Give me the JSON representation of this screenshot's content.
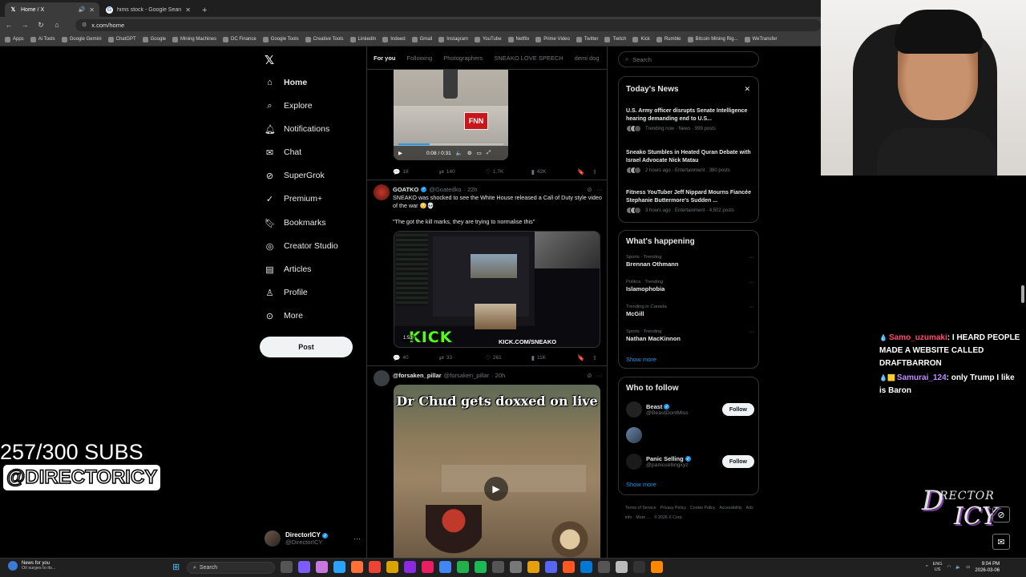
{
  "browser": {
    "tabs": [
      {
        "title": "Home / X",
        "icon": "x-logo-icon",
        "active": true
      },
      {
        "title": "hims stock - Google Search",
        "icon": "google-icon",
        "active": false
      }
    ],
    "url": "x.com/home",
    "bookmarks": [
      "Apps",
      "Ai Tools",
      "Google Gemini",
      "ChatGPT",
      "Google",
      "Mining Machines",
      "DC Finance",
      "Google Tools",
      "Creative Tools",
      "LinkedIn",
      "Indeed",
      "Gmail",
      "Instagram",
      "YouTube",
      "Netflix",
      "Prime Video",
      "Twitter",
      "Twitch",
      "Kick",
      "Rumble",
      "Bitcoin Mining Rig...",
      "WeTransfer"
    ]
  },
  "nav": {
    "items": [
      {
        "label": "Home",
        "icon": "home-icon"
      },
      {
        "label": "Explore",
        "icon": "search-icon"
      },
      {
        "label": "Notifications",
        "icon": "bell-icon"
      },
      {
        "label": "Chat",
        "icon": "mail-icon"
      },
      {
        "label": "SuperGrok",
        "icon": "grok-icon"
      },
      {
        "label": "Premium+",
        "icon": "premium-icon"
      },
      {
        "label": "Bookmarks",
        "icon": "bookmark-icon"
      },
      {
        "label": "Creator Studio",
        "icon": "creator-studio-icon"
      },
      {
        "label": "Articles",
        "icon": "articles-icon"
      },
      {
        "label": "Profile",
        "icon": "profile-icon"
      },
      {
        "label": "More",
        "icon": "more-circle-icon"
      }
    ],
    "post_label": "Post",
    "account": {
      "name": "DirectorICY",
      "handle": "@DirectorICY"
    }
  },
  "timeline": {
    "tabs": [
      "For you",
      "Following",
      "Photographers",
      "SNEAKO LOVE SPEECH",
      "demi dog"
    ],
    "post1": {
      "video_time": "0:08 / 0:31",
      "video_logo": "FNN",
      "replies": "18",
      "reposts": "140",
      "likes": "1.7K",
      "views": "42K"
    },
    "post2": {
      "name": "GOATKO",
      "handle": "@Goatedko",
      "time": "· 22h",
      "text1": "SNEAKO was shocked to see the White House released a Call of Duty style video of the war 😳💀",
      "text2": "\"The got the kill marks, they are trying to normalise this\"",
      "kick_logo": "KICK",
      "kick_url": "KICK.COM/SNEAKO",
      "duration": "1:53",
      "replies": "40",
      "reposts": "33",
      "likes": "261",
      "views": "11K"
    },
    "post3": {
      "name": "@forsaken_pillar",
      "handle": "@forsaken_pillar",
      "time": "· 20h",
      "caption": "Dr Chud gets doxxed on live"
    }
  },
  "sidebar": {
    "search_placeholder": "Search",
    "news_title": "Today's News",
    "news": [
      {
        "title": "U.S. Army officer disrupts Senate Intelligence hearing demanding end to U.S...",
        "meta": "Trending now · News · 999 posts"
      },
      {
        "title": "Sneako Stumbles in Heated Quran Debate with Israel Advocate Nick Matau",
        "meta": "2 hours ago · Entertainment · 380 posts"
      },
      {
        "title": "Fitness YouTuber Jeff Nippard Mourns Fiancée Stephanie Buttermore's Sudden ...",
        "meta": "3 hours ago · Entertainment · 4,502 posts"
      }
    ],
    "happening_title": "What's happening",
    "trends": [
      {
        "category": "Sports · Trending",
        "name": "Brennan Othmann"
      },
      {
        "category": "Politics · Trending",
        "name": "Islamophobia"
      },
      {
        "category": "Trending in Canada",
        "name": "McGill"
      },
      {
        "category": "Sports · Trending",
        "name": "Nathan MacKinnon"
      }
    ],
    "show_more": "Show more",
    "follow_title": "Who to follow",
    "follows": [
      {
        "name": "Beast",
        "handle": "@BeastDontMiss",
        "button": "Follow"
      },
      {
        "name": "Panic Selling",
        "handle": "@panicsellingxyz",
        "button": "Follow"
      }
    ],
    "footer": [
      "Terms of Service",
      "Privacy Policy",
      "Cookie Policy",
      "Accessibility",
      "Ads info",
      "More ...",
      "© 2026 X Corp."
    ]
  },
  "overlay": {
    "subs": "257/300 SUBS",
    "handle": "@DIRECTORICY",
    "chat": [
      {
        "user": "Samo_uzumaki",
        "message": ": I HEARD PEOPLE MADE A WEBSITE CALLED DRAFTBARRON"
      },
      {
        "user": "Samurai_124",
        "message": ": only Trump I like is Baron"
      }
    ],
    "brand_text": "DirectorICY"
  },
  "taskbar": {
    "weather_title": "News for you",
    "weather_sub": "Oil surges to its...",
    "search_placeholder": "Search",
    "lang1": "ENG",
    "lang2": "US",
    "time": "9:04 PM",
    "date": "2026-03-06"
  },
  "colors": {
    "accent": "#1d9bf0",
    "kick_green": "#53fc18",
    "chat_user": "#ff4d6d"
  }
}
